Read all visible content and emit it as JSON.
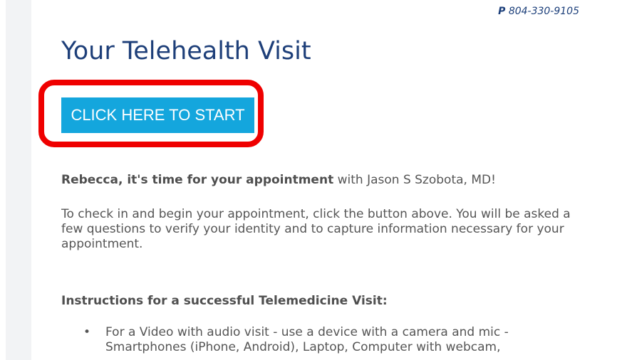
{
  "header": {
    "phone_label": "P",
    "phone_number": "804-330-9105"
  },
  "title": "Your Telehealth Visit",
  "start_button": {
    "label": "CLICK HERE TO START"
  },
  "greeting": {
    "bold": "Rebecca, it's time for your appointment",
    "rest": " with Jason S Szobota, MD!"
  },
  "checkin_text": "To check in and begin your appointment, click the button above. You will be asked a few questions to verify your identity and to capture information necessary for your appointment.",
  "instructions": {
    "heading": "Instructions for a successful Telemedicine Visit:",
    "items": [
      "For a Video with audio visit - use a device with a camera and mic - Smartphones (iPhone, Android), Laptop, Computer with webcam,"
    ]
  },
  "colors": {
    "title": "#1e3f79",
    "button_bg": "#14a6dd",
    "highlight": "#ef0000",
    "text": "#555555"
  }
}
